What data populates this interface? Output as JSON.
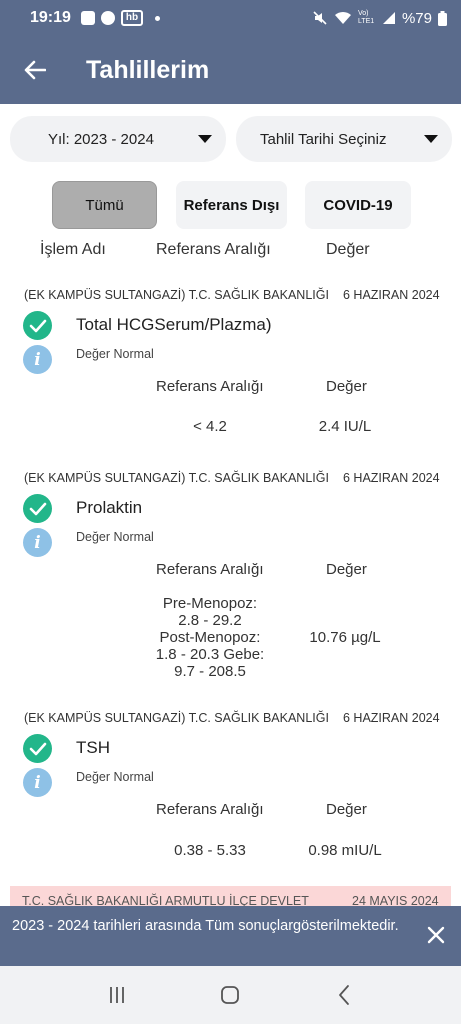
{
  "status_bar": {
    "time": "19:19",
    "battery": "%79",
    "icons": [
      "cube-icon",
      "chat-icon",
      "hb-icon",
      "dot-icon",
      "mute-icon",
      "wifi-icon",
      "volte-icon",
      "signal-icon",
      "battery-icon"
    ],
    "hb_label": "hb",
    "volte_label": "Vo) LTE1"
  },
  "app_bar": {
    "title": "Tahlillerim"
  },
  "filters": {
    "year": "Yıl: 2023 - 2024",
    "date": "Tahlil Tarihi Seçiniz"
  },
  "tabs": [
    {
      "label": "Tümü",
      "active": true
    },
    {
      "label": "Referans Dışı",
      "active": false
    },
    {
      "label": "COVID-19",
      "active": false
    }
  ],
  "columns": {
    "name": "İşlem Adı",
    "reference": "Referans Aralığı",
    "value": "Değer"
  },
  "records": [
    {
      "org": "(EK KAMPÜS SULTANGAZİ) T.C. SAĞLIK BAKANLIĞI",
      "date": "6 HAZIRAN 2024",
      "name": "Total HCGSerum/Plazma)",
      "status": "Değer Normal",
      "ref_header": "Referans Aralığı",
      "val_header": "Değer",
      "reference": "< 4.2",
      "value": "2.4 IU/L"
    },
    {
      "org": "(EK KAMPÜS SULTANGAZİ) T.C. SAĞLIK BAKANLIĞI",
      "date": "6 HAZIRAN 2024",
      "name": "Prolaktin",
      "status": "Değer Normal",
      "ref_header": "Referans Aralığı",
      "val_header": "Değer",
      "reference_lines": [
        "Pre-Menopoz:",
        "2.8 - 29.2",
        "Post-Menopoz:",
        "1.8 - 20.3 Gebe:",
        "9.7 - 208.5"
      ],
      "value": "10.76 µg/L"
    },
    {
      "org": "(EK KAMPÜS SULTANGAZİ) T.C. SAĞLIK BAKANLIĞI",
      "date": "6 HAZIRAN 2024",
      "name": "TSH",
      "status": "Değer Normal",
      "ref_header": "Referans Aralığı",
      "val_header": "Değer",
      "reference": "0.38 - 5.33",
      "value": "0.98 mIU/L"
    }
  ],
  "partial_record": {
    "org": "T.C. SAĞLIK BAKANLIĞI ARMUTLU İLÇE DEVLET",
    "date": "24 MAYIS 2024"
  },
  "snackbar": {
    "message": "2023 - 2024 tarihleri arasında Tüm sonuçlargösterilmektedir."
  },
  "colors": {
    "header": "#5a6b8c",
    "check": "#22b68a",
    "info": "#8ec1e6",
    "alert": "#fbd7d7"
  }
}
